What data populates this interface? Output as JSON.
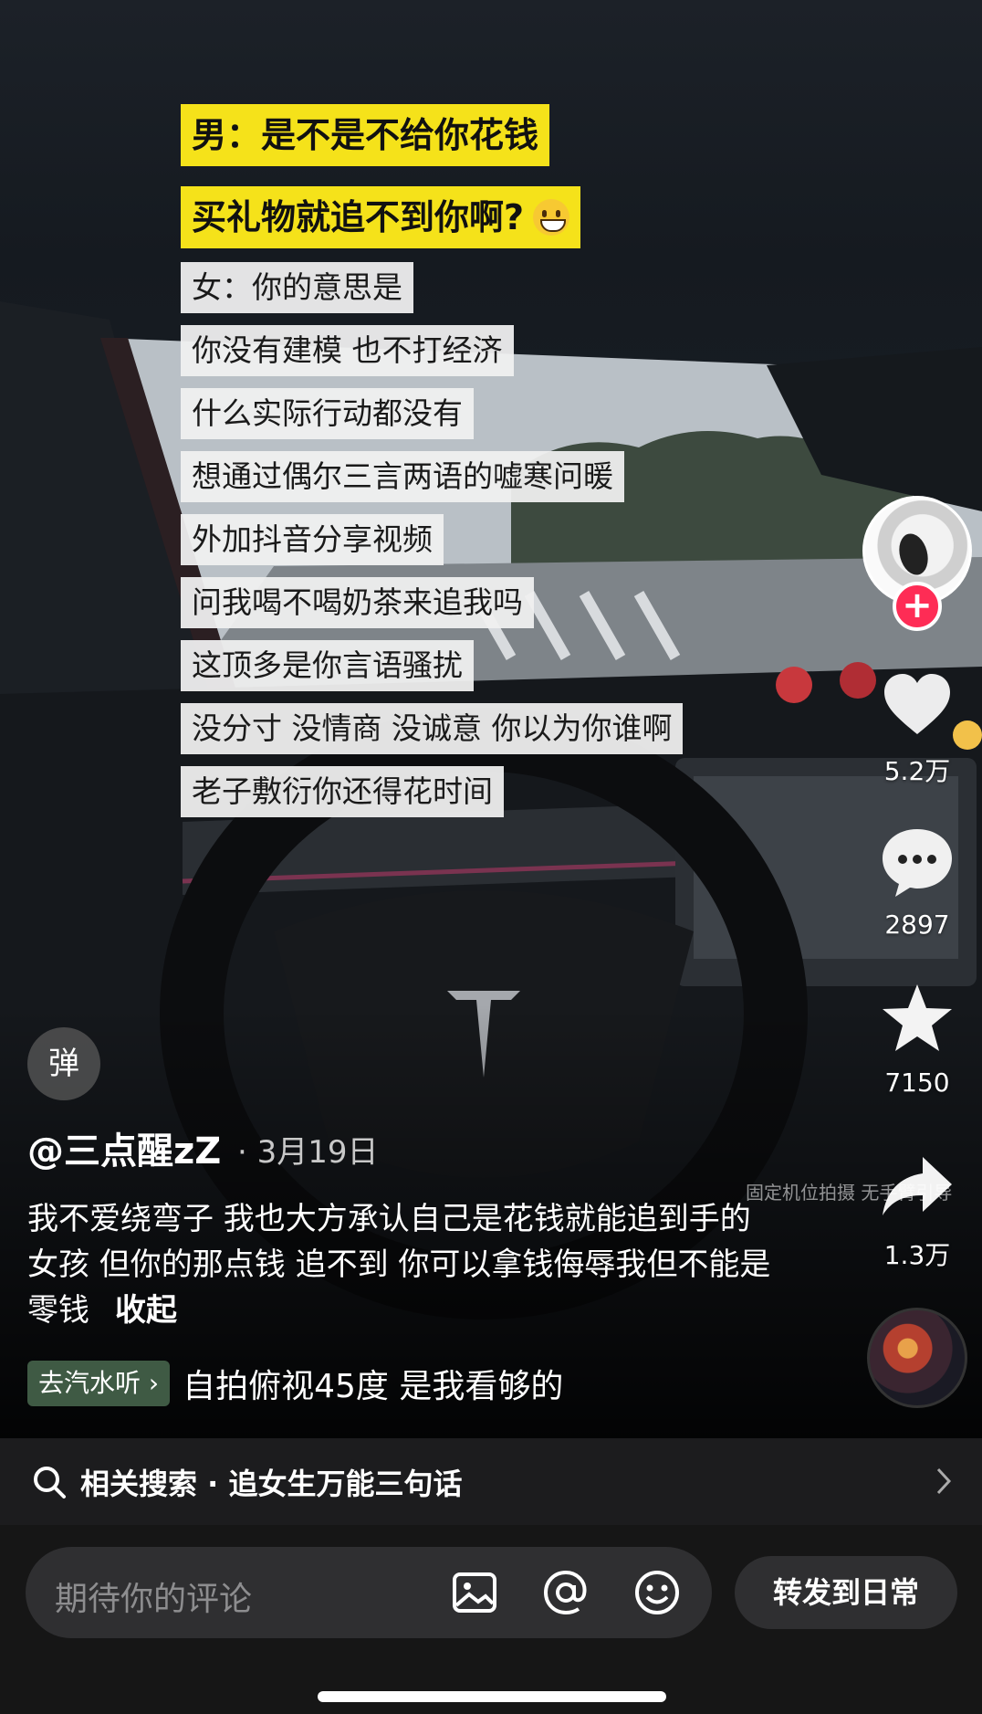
{
  "captions": {
    "man_line1": "男：是不是不给你花钱",
    "man_line2": "买礼物就追不到你啊?",
    "lines": [
      "女：你的意思是",
      "你没有建模 也不打经济",
      "什么实际行动都没有",
      "想通过偶尔三言两语的嘘寒问暖",
      "外加抖音分享视频",
      "问我喝不喝奶茶来追我吗",
      "这顶多是你言语骚扰",
      "没分寸 没情商 没诚意 你以为你谁啊",
      "老子敷衍你还得花时间"
    ]
  },
  "sidebar": {
    "follow_symbol": "+",
    "likes": "5.2万",
    "comments": "2897",
    "favorites": "7150",
    "shares": "1.3万"
  },
  "post": {
    "danmu_label": "弹",
    "author": "@三点醒zZ",
    "date": "· 3月19日",
    "watermark": "固定机位拍摄 无手臂引导",
    "description": "我不爱绕弯子 我也大方承认自己是花钱就能追到手的女孩 但你的那点钱 追不到 你可以拿钱侮辱我但不能是零钱",
    "collapse": "收起",
    "tag": "去汽水听 ›",
    "music": "自拍俯视45度 是我看够的"
  },
  "related_search": {
    "label": "相关搜索 · 追女生万能三句话"
  },
  "comment_bar": {
    "placeholder": "期待你的评论",
    "share_label": "转发到日常"
  },
  "colors": {
    "caption_yellow": "#f5e21a",
    "follow_red": "#fe2c55",
    "tag_green": "#3f5a44"
  },
  "icons": [
    "heart-icon",
    "comment-icon",
    "star-icon",
    "share-icon",
    "search-icon",
    "chevron-right-icon",
    "image-icon",
    "at-icon",
    "emoji-icon",
    "smiley-emoji"
  ]
}
